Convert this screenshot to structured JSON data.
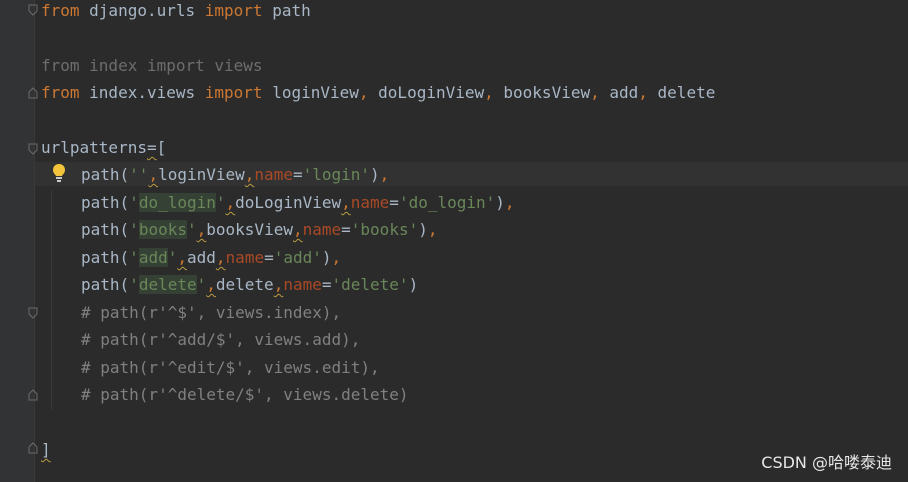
{
  "code": {
    "line1": {
      "kw1": "from",
      "mod": " django.urls ",
      "kw2": "import",
      "name": " path"
    },
    "line3": {
      "text": "from index import views"
    },
    "line4": {
      "kw1": "from",
      "mod": " index.views ",
      "kw2": "import",
      "n1": " loginView",
      "c1": ",",
      "n2": " doLoginView",
      "c2": ",",
      "n3": " booksView",
      "c3": ",",
      "n4": " add",
      "c4": ",",
      "n5": " delete"
    },
    "line6": {
      "name": "urlpatterns",
      "eq": "=",
      "br": "["
    },
    "route1": {
      "fn": "path(",
      "str": "''",
      "comma": ",",
      "view": "loginView",
      "c2": ",",
      "param": "name",
      "eq": "=",
      "name": "'login'",
      "close": ")",
      "trail": ","
    },
    "route2": {
      "fn": "path(",
      "q1": "'",
      "strInner": "do_login",
      "q2": "'",
      "comma": ",",
      "view": "doLoginView",
      "c2": ",",
      "param": "name",
      "eq": "=",
      "name": "'do_login'",
      "close": ")",
      "trail": ","
    },
    "route3": {
      "fn": "path(",
      "q1": "'",
      "strInner": "books",
      "q2": "'",
      "comma": ",",
      "view": "booksView",
      "c2": ",",
      "param": "name",
      "eq": "=",
      "name": "'books'",
      "close": ")",
      "trail": ","
    },
    "route4": {
      "fn": "path(",
      "q1": "'",
      "strInner": "add",
      "q2": "'",
      "comma": ",",
      "view": "add",
      "c2": ",",
      "param": "name",
      "eq": "=",
      "name": "'add'",
      "close": ")",
      "trail": ","
    },
    "route5": {
      "fn": "path(",
      "q1": "'",
      "strInner": "delete",
      "q2": "'",
      "comma": ",",
      "view": "delete",
      "c2": ",",
      "param": "name",
      "eq": "=",
      "name": "'delete'",
      "close": ")"
    },
    "comment1": "# path(r'^$', views.index),",
    "comment2": "# path(r'^add/$', views.add),",
    "comment3": "# path(r'^edit/$', views.edit),",
    "comment4": "# path(r'^delete/$', views.delete)",
    "closing": "]"
  },
  "watermark": "CSDN @哈喽泰迪",
  "icons": {
    "bulb": "lightbulb-icon",
    "fold": "fold-marker-icon"
  },
  "colors": {
    "background": "#2b2b2b",
    "keyword": "#cc7832",
    "string": "#6a8759",
    "parameter": "#aa4926",
    "comment": "#808080",
    "identifier": "#a9b7c6",
    "bulb": "#f2c33b"
  }
}
